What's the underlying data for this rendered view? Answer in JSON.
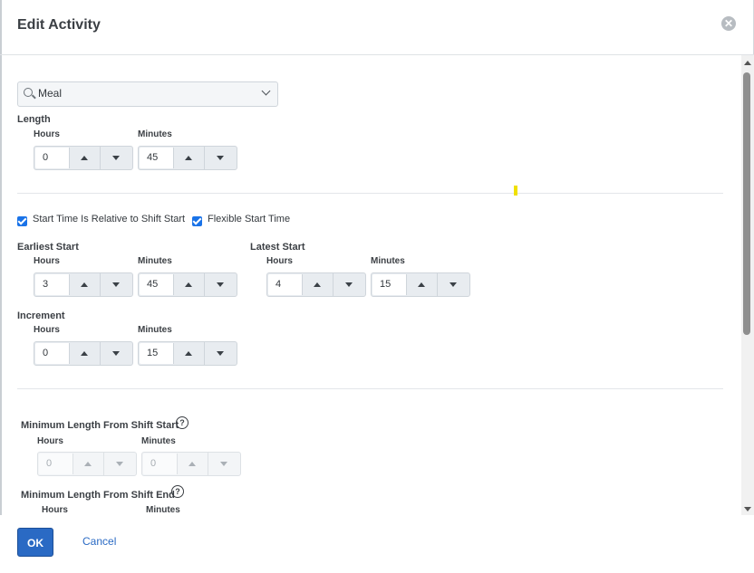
{
  "dialog": {
    "title": "Edit Activity"
  },
  "activity_select": {
    "value": "Meal"
  },
  "length": {
    "label": "Length",
    "hours": {
      "label": "Hours",
      "value": "0"
    },
    "minutes": {
      "label": "Minutes",
      "value": "45"
    }
  },
  "checkboxes": {
    "relative_to_shift_start": {
      "label": "Start Time Is Relative to Shift Start",
      "checked": true
    },
    "flexible_start_time": {
      "label": "Flexible Start Time",
      "checked": true
    }
  },
  "earliest_start": {
    "label": "Earliest Start",
    "hours": {
      "label": "Hours",
      "value": "3"
    },
    "minutes": {
      "label": "Minutes",
      "value": "45"
    }
  },
  "latest_start": {
    "label": "Latest Start",
    "hours": {
      "label": "Hours",
      "value": "4"
    },
    "minutes": {
      "label": "Minutes",
      "value": "15"
    }
  },
  "increment": {
    "label": "Increment",
    "hours": {
      "label": "Hours",
      "value": "0"
    },
    "minutes": {
      "label": "Minutes",
      "value": "15"
    }
  },
  "min_length_from_start": {
    "label": "Minimum Length From Shift Start",
    "hours": {
      "label": "Hours",
      "value": "0"
    },
    "minutes": {
      "label": "Minutes",
      "value": "0"
    }
  },
  "min_length_from_end": {
    "label": "Minimum Length From Shift End",
    "hours": {
      "label": "Hours"
    },
    "minutes": {
      "label": "Minutes"
    }
  },
  "footer": {
    "ok_label": "OK",
    "cancel_label": "Cancel"
  },
  "colors": {
    "primary": "#2a6ac4",
    "checkbox": "#1a73e8",
    "marker": "#f0e000"
  }
}
